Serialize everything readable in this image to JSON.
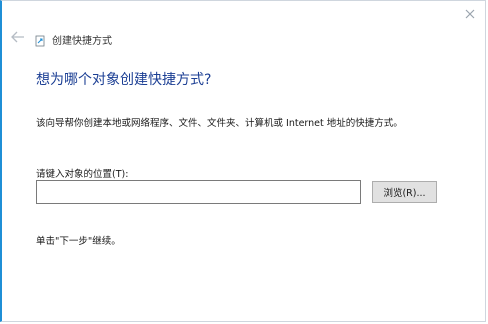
{
  "wizard": {
    "title": "创建快捷方式",
    "heading": "想为哪个对象创建快捷方式?",
    "description": "该向导帮你创建本地或网络程序、文件、文件夹、计算机或 Internet 地址的快捷方式。",
    "location_label": "请键入对象的位置(T):",
    "location_value": "",
    "browse_label": "浏览(R)...",
    "instruction": "单击\"下一步\"继续。"
  },
  "icons": {
    "back": "back-arrow-icon",
    "close": "close-icon",
    "wizard": "shortcut-wizard-icon"
  },
  "colors": {
    "heading": "#1c3f94",
    "window_accent": "#1f8fd6",
    "button_bg": "#e1e1e1"
  }
}
